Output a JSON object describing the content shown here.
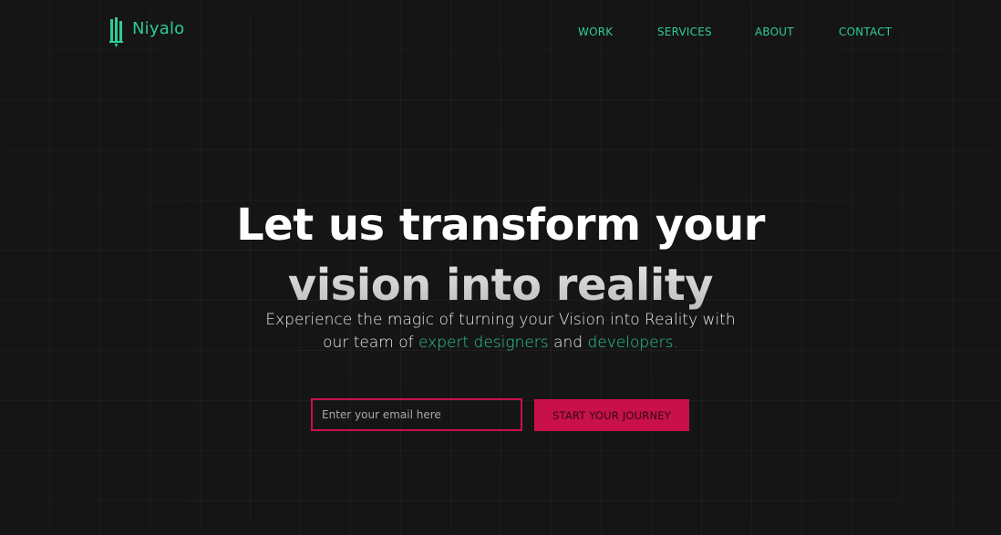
{
  "brand": {
    "name": "Niyalo",
    "icon": "pencil-bars-logo-icon"
  },
  "nav": {
    "items": [
      "WORK",
      "SERVICES",
      "ABOUT",
      "CONTACT"
    ]
  },
  "hero": {
    "headline_line1": "Let us transform your",
    "headline_line2": "vision into reality",
    "subtitle_part1": "Experience the magic of turning your Vision into Reality with",
    "subtitle_part2": "our team of",
    "subtitle_accent1": "expert designers",
    "subtitle_part3": "and",
    "subtitle_accent2": "developers."
  },
  "signup": {
    "email_placeholder": "Enter your email here",
    "email_value": "",
    "button_label": "START YOUR JOURNEY"
  },
  "colors": {
    "accent": "#2ecc93",
    "cta": "#c8104a",
    "background": "#151515"
  }
}
